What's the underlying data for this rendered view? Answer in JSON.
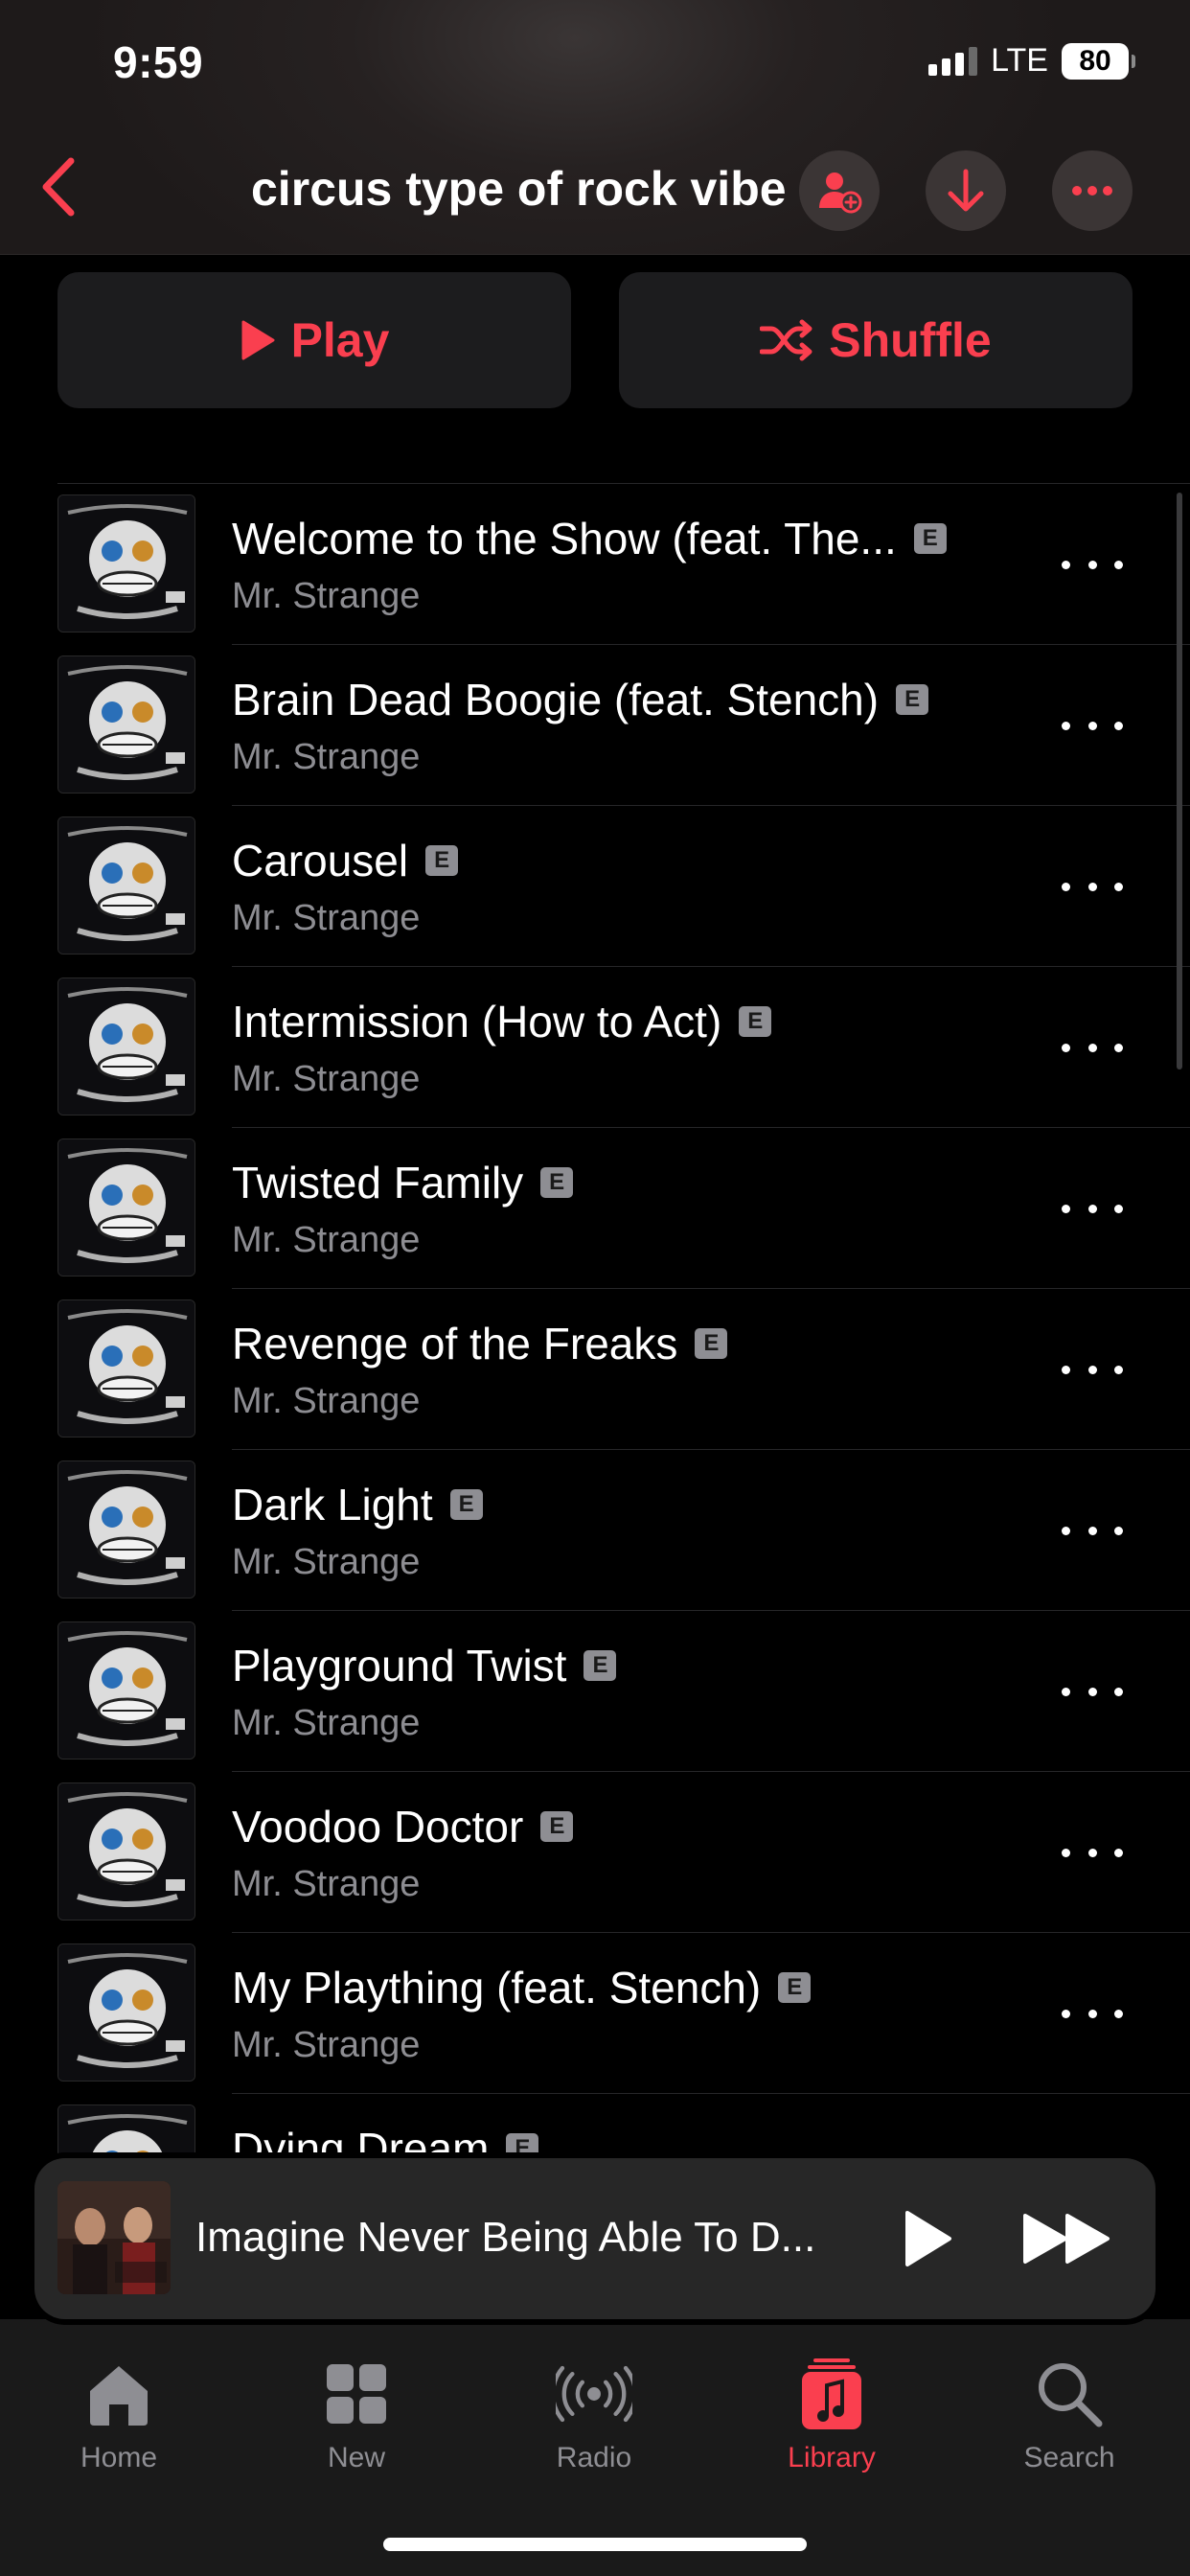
{
  "status_bar": {
    "time": "9:59",
    "network": "LTE",
    "battery": "80"
  },
  "header": {
    "title": "circus type of rock vibe"
  },
  "actions": {
    "play_label": "Play",
    "shuffle_label": "Shuffle"
  },
  "explicit_badge": "E",
  "tracks": [
    {
      "title": "Welcome to the Show (feat. The...",
      "artist": "Mr. Strange"
    },
    {
      "title": "Brain Dead Boogie (feat. Stench)",
      "artist": "Mr. Strange"
    },
    {
      "title": "Carousel",
      "artist": "Mr. Strange"
    },
    {
      "title": "Intermission (How to Act)",
      "artist": "Mr. Strange"
    },
    {
      "title": "Twisted Family",
      "artist": "Mr. Strange"
    },
    {
      "title": "Revenge of the Freaks",
      "artist": "Mr. Strange"
    },
    {
      "title": "Dark Light",
      "artist": "Mr. Strange"
    },
    {
      "title": "Playground Twist",
      "artist": "Mr. Strange"
    },
    {
      "title": "Voodoo Doctor",
      "artist": "Mr. Strange"
    },
    {
      "title": "My Plaything (feat. Stench)",
      "artist": "Mr. Strange"
    },
    {
      "title": "Dying Dream",
      "artist": ""
    }
  ],
  "now_playing": {
    "title": "Imagine Never Being Able To D..."
  },
  "tab_bar": [
    {
      "label": "Home",
      "icon": "home-icon"
    },
    {
      "label": "New",
      "icon": "grid-icon"
    },
    {
      "label": "Radio",
      "icon": "radio-icon"
    },
    {
      "label": "Library",
      "icon": "library-icon",
      "active": true
    },
    {
      "label": "Search",
      "icon": "search-icon"
    }
  ],
  "colors": {
    "accent": "#fa3f4f",
    "background": "#000000",
    "secondary_text": "#8d8d92"
  }
}
